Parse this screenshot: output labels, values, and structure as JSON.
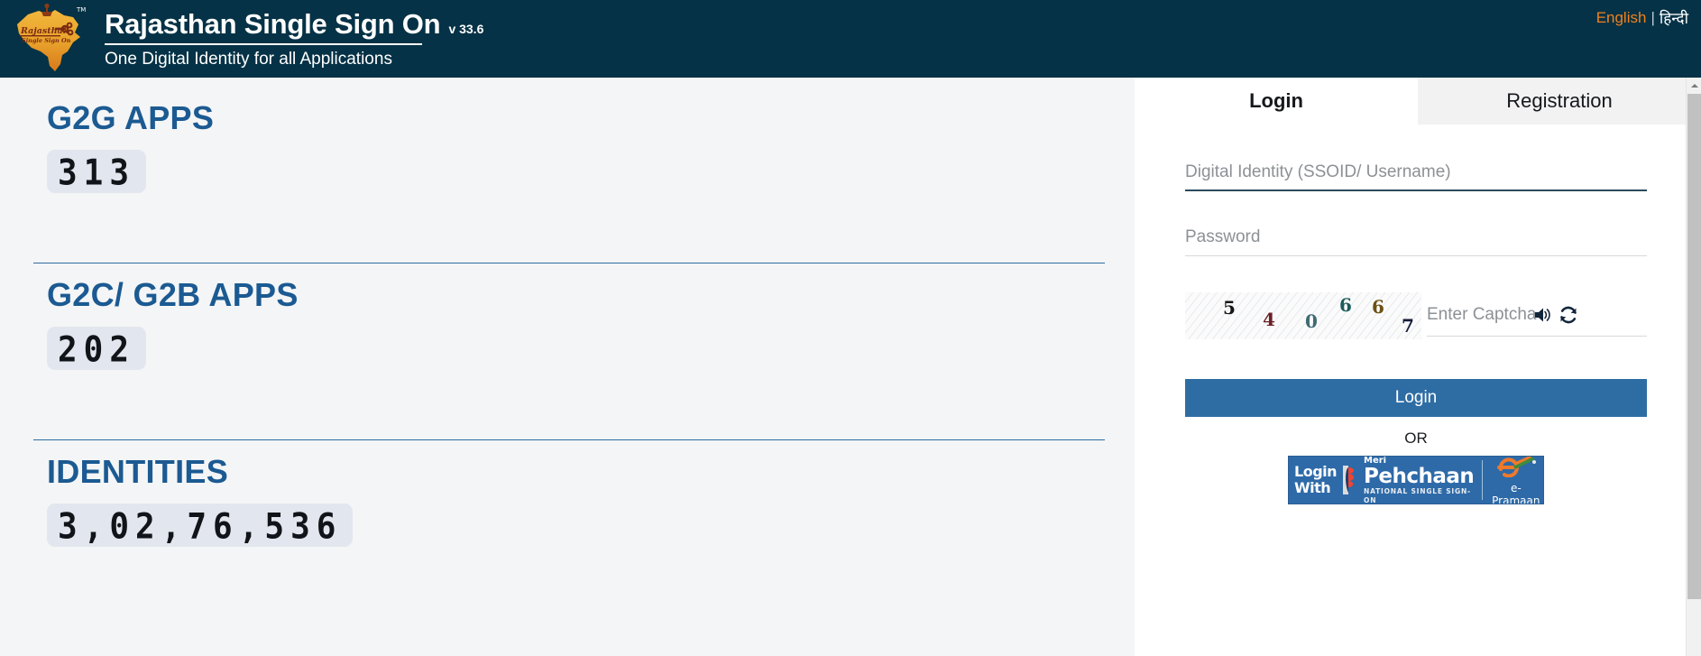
{
  "header": {
    "logo_alt": "Rajasthan Single Sign On",
    "logo_map_text_line1": "Rajasthan",
    "logo_map_text_line2": "Single Sign On",
    "logo_tm": "TM",
    "title": "Rajasthan Single Sign On",
    "version": "v 33.6",
    "subtitle": "One Digital Identity for all Applications",
    "lang_english": "English",
    "lang_separator": "|",
    "lang_hindi": "हिन्दी",
    "bg_color": "#053246",
    "accent_orange": "#f0821e"
  },
  "stats": [
    {
      "title": "G2G APPS",
      "count": "313"
    },
    {
      "title": "G2C/ G2B APPS",
      "count": "202"
    },
    {
      "title": "IDENTITIES",
      "count": "3,02,76,536"
    }
  ],
  "login_panel": {
    "tabs": [
      {
        "label": "Login",
        "active": true
      },
      {
        "label": "Registration",
        "active": false
      }
    ],
    "digital_identity": {
      "placeholder": "Digital Identity (SSOID/ Username)",
      "value": ""
    },
    "password": {
      "placeholder": "Password",
      "value": ""
    },
    "captcha": {
      "digits": [
        "5",
        "4",
        "0",
        "6",
        "6",
        "7"
      ],
      "text": "540667",
      "input_placeholder": "Enter Captcha",
      "input_value": "",
      "speaker_icon": "speaker-icon",
      "refresh_icon": "refresh-icon"
    },
    "login_button": "Login",
    "or_text": "OR",
    "accent_blue": "#2e6da4"
  },
  "pehchaan_banner": {
    "login_with_line1": "Login",
    "login_with_line2": "With",
    "meri": "Meri",
    "pehchaan": "Pehchaan",
    "tagline": "NATIONAL SINGLE SIGN-ON",
    "epramaan": "e-Pramaan",
    "bg_color": "#2e6aa8"
  }
}
